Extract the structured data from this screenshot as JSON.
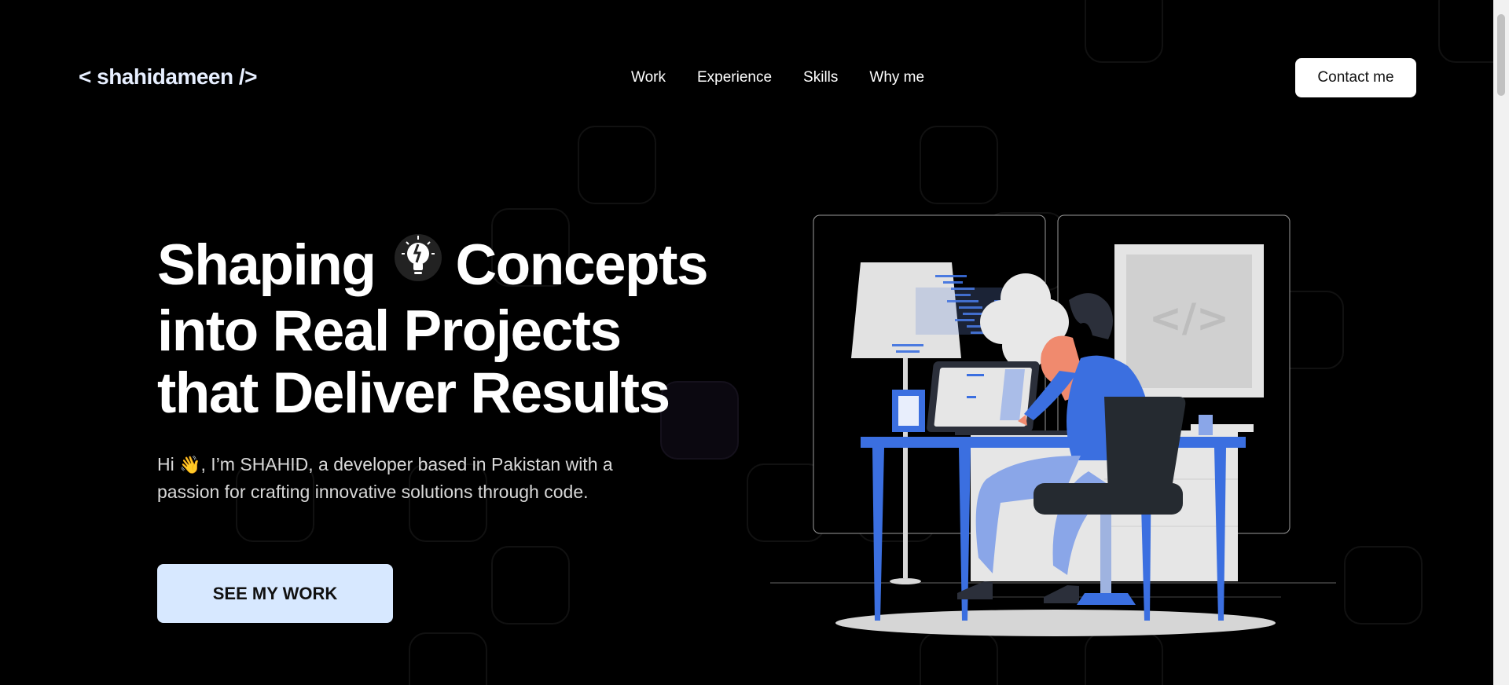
{
  "brand": {
    "logo": "< shahidameen />"
  },
  "nav": {
    "items": [
      {
        "label": "Work"
      },
      {
        "label": "Experience"
      },
      {
        "label": "Skills"
      },
      {
        "label": "Why me"
      }
    ],
    "contact_label": "Contact me"
  },
  "hero": {
    "headline_line1a": "Shaping",
    "headline_line1b": "Concepts",
    "headline_line2": "into Real Projects",
    "headline_line3": "that Deliver Results",
    "intro_before_wave": "Hi ",
    "wave_emoji": "👋",
    "intro_after_wave": ", I’m SHAHID, a developer based in Pakistan with a passion for crafting innovative solutions through code.",
    "cta_label": "SEE MY WORK",
    "bulb_icon": "idea-bulb-icon"
  },
  "illustration": {
    "code_symbol": "</>",
    "accent_color": "#3b6fe0"
  },
  "colors": {
    "background": "#000000",
    "cta_background": "#d7e8ff",
    "logo_color": "#e7efff"
  }
}
